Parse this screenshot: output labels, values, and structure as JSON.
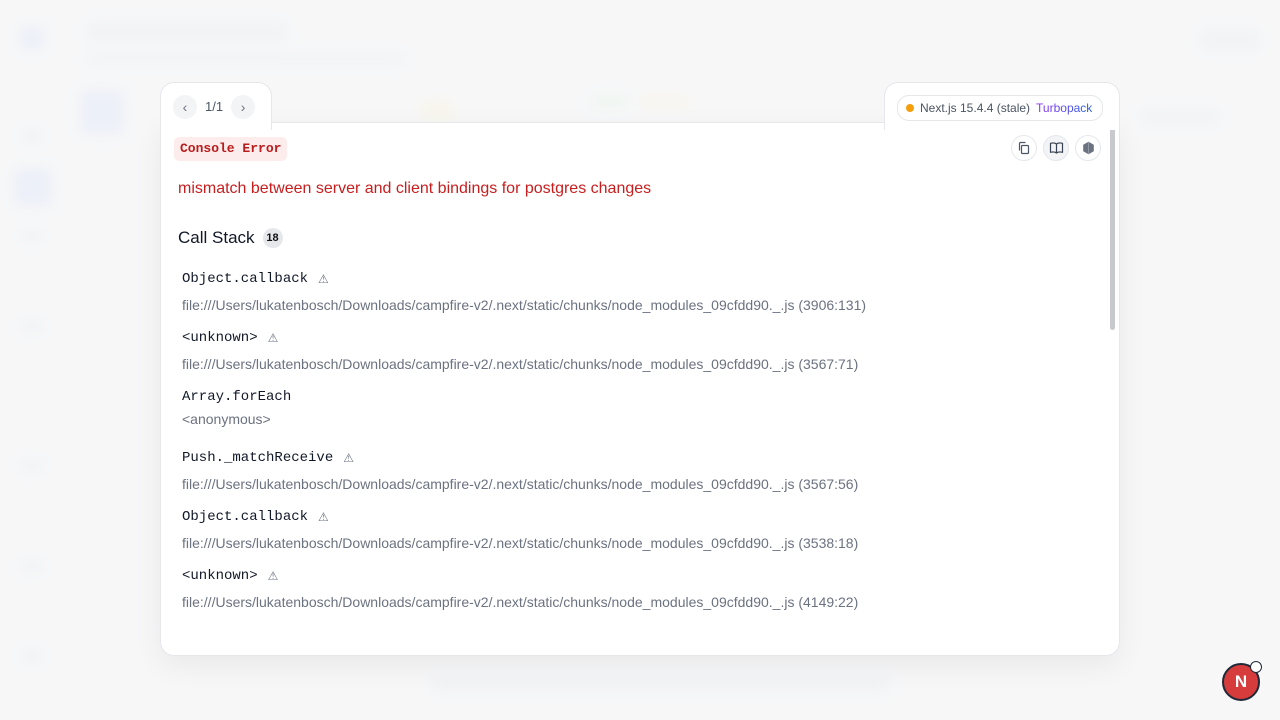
{
  "pager": {
    "position": "1/1"
  },
  "version": {
    "label": "Next.js 15.4.4 (stale)",
    "bundler": "Turbopack",
    "status_color": "#f59e0b"
  },
  "error": {
    "badge": "Console Error",
    "message": "mismatch between server and client bindings for postgres changes",
    "message_color": "#c81e1e"
  },
  "toolbar": {
    "copy_icon": "copy-icon",
    "docs_icon": "book-icon",
    "node_icon": "nodejs-icon"
  },
  "call_stack": {
    "title": "Call Stack",
    "count": "18",
    "frames": [
      {
        "fn": "Object.callback",
        "warn": "⚠",
        "loc": "file:///Users/lukatenbosch/Downloads/campfire-v2/.next/static/chunks/node_modules_09cfdd90._.js (3906:131)"
      },
      {
        "fn": "<unknown>",
        "warn": "⚠",
        "loc": "file:///Users/lukatenbosch/Downloads/campfire-v2/.next/static/chunks/node_modules_09cfdd90._.js (3567:71)"
      },
      {
        "fn": "Array.forEach",
        "warn": "",
        "loc": "<anonymous>"
      },
      {
        "fn": "Push._matchReceive",
        "warn": "⚠",
        "loc": "file:///Users/lukatenbosch/Downloads/campfire-v2/.next/static/chunks/node_modules_09cfdd90._.js (3567:56)"
      },
      {
        "fn": "Object.callback",
        "warn": "⚠",
        "loc": "file:///Users/lukatenbosch/Downloads/campfire-v2/.next/static/chunks/node_modules_09cfdd90._.js (3538:18)"
      },
      {
        "fn": "<unknown>",
        "warn": "⚠",
        "loc": "file:///Users/lukatenbosch/Downloads/campfire-v2/.next/static/chunks/node_modules_09cfdd90._.js (4149:22)"
      }
    ]
  },
  "next_badge": {
    "letter": "N"
  }
}
